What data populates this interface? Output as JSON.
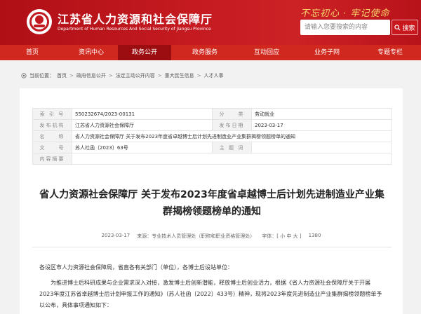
{
  "header": {
    "title": "江苏省人力资源和社会保障厅",
    "subtitle": "Department of Human Resources And Social Security of Jiangsu Province",
    "slogan": "不忘初心 · 牢记使命",
    "search_placeholder": "请输入您要搜索的内容",
    "search_label": "搜索"
  },
  "colors": {
    "primary": "#c8181e",
    "nav": "#d0281f",
    "nav_active": "#9c0d12",
    "slogan": "#f7d26b"
  },
  "nav": {
    "items": [
      {
        "label": "首页",
        "icon": ""
      },
      {
        "label": "资讯中心"
      },
      {
        "label": "政务公开",
        "active": true
      },
      {
        "label": "政务服务"
      },
      {
        "label": "互动回应"
      },
      {
        "label": "业务子网"
      },
      {
        "label": "专题专栏"
      }
    ]
  },
  "breadcrumb": {
    "prefix": "当前位置：",
    "items": [
      "首页",
      "政府信息公开",
      "法定主动公开内容",
      "重大民生信息",
      "人才人事"
    ]
  },
  "meta": {
    "rows": [
      {
        "l1": "索 引 号",
        "v1": "550232674/2023-00131",
        "l2": "分　　类",
        "v2": "劳动就业"
      },
      {
        "l1": "发布机构",
        "v1": "江苏省人力资源社会保障厅",
        "l2": "发布日期",
        "v2": "2023-03-17"
      },
      {
        "l1": "名　　称",
        "v1": "省人力资源社会保障厅 关于发布2023年度省卓越博士后计划先进制造业产业集群揭榜领题榜单的通知"
      },
      {
        "l1": "文　　号",
        "v1": "苏人社函〔2023〕63号",
        "l2": "主 题 词",
        "v2": ""
      },
      {
        "l1": "内容摘要",
        "v1": ""
      }
    ]
  },
  "doc": {
    "title": "省人力资源社会保障厅 关于发布2023年度省卓越博士后计划先进制造业产业集群揭榜领题榜单的通知",
    "date": "2023-03-17",
    "source": "来源：专业技术人员管理处（职称和职业资格管理处）",
    "font_size": "字体：[ 小 中 大 ]",
    "views": "1380"
  },
  "body": {
    "p1": "各设区市人力资源社会保障局，省直各有关部门（单位），各博士后设站单位：",
    "p2": "为推进博士后科研成果与企业需求深入对接，激发博士后创新潜能，释放博士后创业活力，根据《省人力资源社会保障厅关于开展2023年度江苏省卓越博士后计划申报工作的通知》（苏人社函〔2022〕433号）精神，现将2023年度先进制造业产业集群揭榜领题榜单予以公布，具体事项通知如下："
  }
}
